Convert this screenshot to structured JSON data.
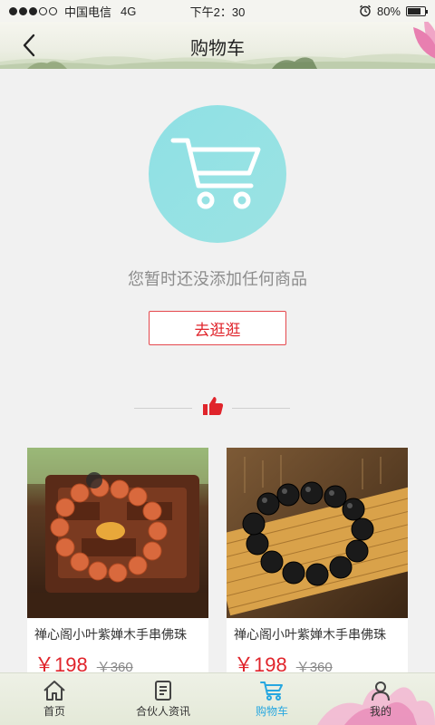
{
  "status_bar": {
    "carrier": "中国电信",
    "network": "4G",
    "time": "下午2：30",
    "battery": "80%",
    "battery_level": 0.8,
    "signal_bars_filled": 3,
    "signal_bars_total": 5
  },
  "header": {
    "title": "购物车"
  },
  "empty_state": {
    "message": "您暂时还没添加任何商品",
    "button_label": "去逛逛",
    "circle_color": "#96e1e4"
  },
  "products": [
    {
      "name": "禅心阁小叶紫婵木手串佛珠",
      "price": "￥198",
      "old_price": "￥360"
    },
    {
      "name": "禅心阁小叶紫婵木手串佛珠",
      "price": "￥198",
      "old_price": "￥360"
    }
  ],
  "bottom_nav": [
    {
      "label": "首页",
      "icon": "home-icon"
    },
    {
      "label": "合伙人资讯",
      "icon": "document-icon"
    },
    {
      "label": "购物车",
      "icon": "cart-icon",
      "active": true
    },
    {
      "label": "我的",
      "icon": "user-icon"
    }
  ],
  "colors": {
    "accent_red": "#e0242b",
    "active_blue": "#27a7e0"
  }
}
